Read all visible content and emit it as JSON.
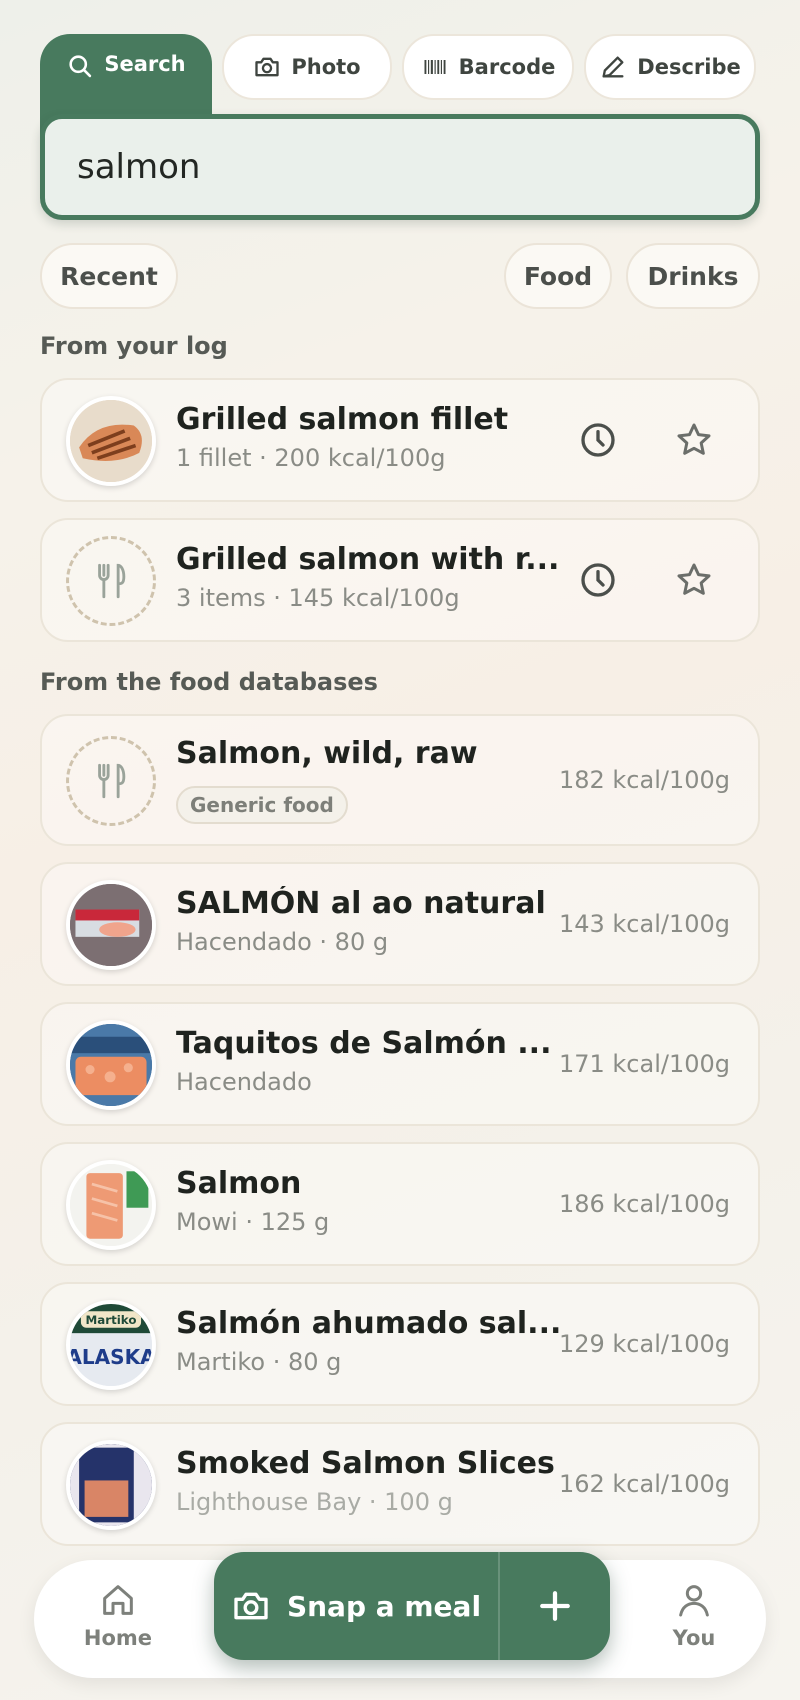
{
  "tabs": {
    "search": "Search",
    "photo": "Photo",
    "barcode": "Barcode",
    "describe": "Describe"
  },
  "search": {
    "value": "salmon"
  },
  "filters": {
    "recent": "Recent",
    "food": "Food",
    "drinks": "Drinks"
  },
  "sections": {
    "log": "From your log",
    "databases": "From the food databases"
  },
  "log_items": [
    {
      "name": "Grilled salmon fillet",
      "sub": "1 fillet · 200 kcal/100g"
    },
    {
      "name": "Grilled salmon with r...",
      "sub": "3 items · 145 kcal/100g"
    }
  ],
  "db_items": [
    {
      "name": "Salmon, wild, raw",
      "badge": "Generic food",
      "kcal": "182 kcal/100g"
    },
    {
      "name": "SALMÓN al ao natural",
      "sub": "Hacendado · 80 g",
      "kcal": "143 kcal/100g"
    },
    {
      "name": "Taquitos de Salmón ...",
      "sub": "Hacendado",
      "kcal": "171 kcal/100g"
    },
    {
      "name": "Salmon",
      "sub": "Mowi · 125 g",
      "kcal": "186 kcal/100g"
    },
    {
      "name": "Salmón ahumado sal...",
      "sub": "Martiko · 80 g",
      "kcal": "129 kcal/100g"
    },
    {
      "name": "Smoked Salmon Slices",
      "sub": "Lighthouse Bay · 100 g",
      "kcal": "162 kcal/100g"
    }
  ],
  "thumb_labels": {
    "martiko": "Martiko",
    "alaska": "ALASKA"
  },
  "nav": {
    "home": "Home",
    "snap": "Snap a meal",
    "you": "You"
  },
  "colors": {
    "accent": "#487a5e",
    "card_border": "#ebe5d9",
    "muted_text": "#8a8c86"
  },
  "icons": {
    "search": "search-icon",
    "photo": "camera-icon",
    "barcode": "barcode-icon",
    "describe": "pencil-icon",
    "history": "clock-icon",
    "favorite": "star-icon",
    "placeholder": "fork-knife-icon",
    "home": "home-icon",
    "you": "user-icon",
    "add": "plus-icon"
  }
}
